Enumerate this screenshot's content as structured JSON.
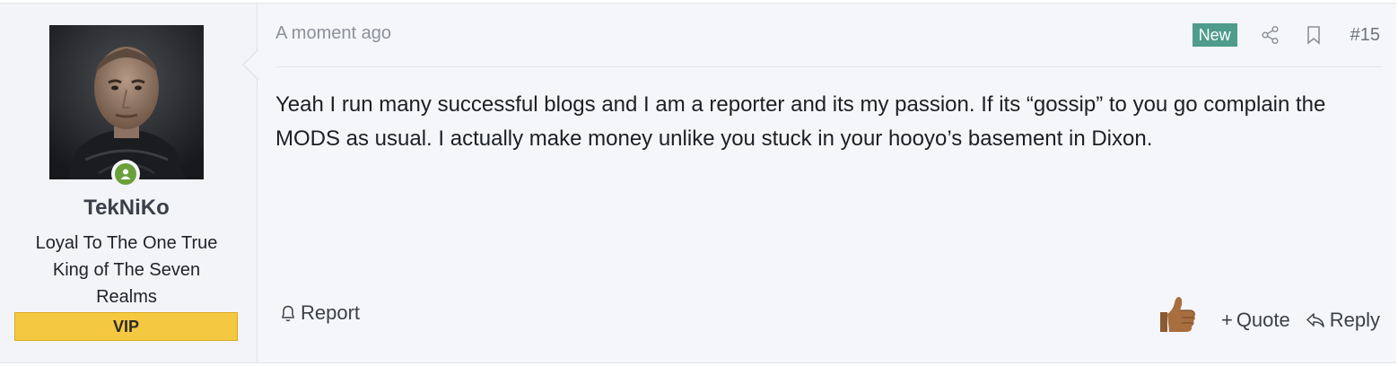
{
  "user": {
    "name": "TekNiKo",
    "title": "Loyal To The One True King of The Seven Realms",
    "badge": "VIP",
    "online_color": "#6aa03a",
    "badge_color": "#f5c842"
  },
  "post": {
    "time": "A moment ago",
    "new_label": "New",
    "number": "#15",
    "body": "Yeah I run many successful blogs and I am a reporter and its my passion. If its “gossip” to you go complain the MODS as usual. I actually make money unlike you stuck in your hooyo’s basement in Dixon.",
    "header_icons": [
      "share-icon",
      "bookmark-icon"
    ],
    "accent_color": "#4f9c8c"
  },
  "footer": {
    "report_label": "Report",
    "quote_label": "Quote",
    "reply_label": "Reply",
    "reaction_icon": "thumbs-up-icon"
  }
}
